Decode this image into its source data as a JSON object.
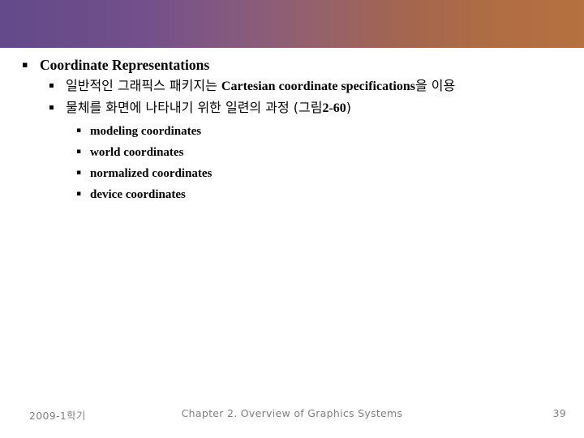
{
  "slide": {
    "header": {
      "gradient_start": "#634A8B",
      "gradient_mid": "#93606F",
      "gradient_end": "#B5713F"
    },
    "background_color": "#FFFFFF",
    "text_color": "#000000",
    "bullet_glyph": "▪",
    "body": {
      "level1": [
        {
          "text": "Coordinate Representations"
        }
      ],
      "level2": [
        {
          "korean_lead": "일반적인 그래픽스 패키지는 ",
          "english": "Cartesian coordinate specifications",
          "korean_tail": "을 이용"
        },
        {
          "korean_lead": "물체를 화면에 나타내기 위한 일련의 과정 (그림",
          "english": "2-60",
          "korean_tail": ")"
        }
      ],
      "level3": [
        {
          "text": "modeling coordinates"
        },
        {
          "text": "world coordinates"
        },
        {
          "text": "normalized coordinates"
        },
        {
          "text": "device coordinates"
        }
      ]
    },
    "footer": {
      "left": "2009-1학기",
      "center": "Chapter 2. Overview of Graphics Systems",
      "page_number": "39",
      "color": "#808080"
    }
  }
}
